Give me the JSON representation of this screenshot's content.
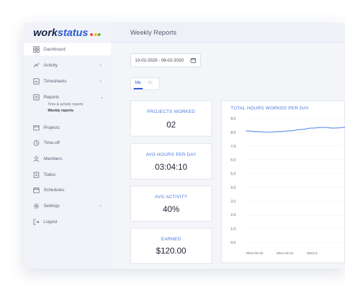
{
  "app": {
    "logo_text": "work",
    "logo_accent": "status",
    "logo_dots": [
      "#e8452c",
      "#f2b233",
      "#47b04b"
    ]
  },
  "header": {
    "title": "Weekly Reports"
  },
  "sidebar": {
    "items": [
      {
        "label": "Dashboard",
        "icon": "dashboard-icon",
        "has_chevron": false,
        "active": true
      },
      {
        "label": "Activity",
        "icon": "activity-icon",
        "has_chevron": true
      },
      {
        "label": "Timesheets",
        "icon": "timesheet-icon",
        "has_chevron": true
      },
      {
        "label": "Reports",
        "icon": "reports-icon",
        "has_chevron": true,
        "expanded": true
      },
      {
        "label": "Projects",
        "icon": "projects-icon",
        "has_chevron": false
      },
      {
        "label": "Time-off",
        "icon": "timeoff-icon",
        "has_chevron": false
      },
      {
        "label": "Members",
        "icon": "members-icon",
        "has_chevron": false
      },
      {
        "label": "Todos",
        "icon": "todos-icon",
        "has_chevron": false
      },
      {
        "label": "Schedules",
        "icon": "schedules-icon",
        "has_chevron": false
      },
      {
        "label": "Settings",
        "icon": "settings-icon",
        "has_chevron": true
      },
      {
        "label": "Logout",
        "icon": "logout-icon",
        "has_chevron": false
      }
    ],
    "reports_sub": [
      "Time & activity reports",
      "Weekly reports"
    ]
  },
  "filters": {
    "date_range": "10-02-2020 - 09-02-2020",
    "toggle_me": "Me",
    "toggle_all": "All"
  },
  "cards": [
    {
      "title": "PROJECTS WORKED",
      "value": "02"
    },
    {
      "title": "AVG HOURS PER DAY",
      "value": "03:04:10"
    },
    {
      "title": "AVG ACTIVITY",
      "value": "40%"
    },
    {
      "title": "EARNED",
      "value": "$120.00"
    }
  ],
  "colors": {
    "accent": "#4b78e2",
    "line": "#5b8be6"
  },
  "chart_data": {
    "type": "line",
    "title": "TOTAL HOURS WORKED PER DAY",
    "ylim": [
      0,
      9
    ],
    "y_ticks": [
      "9.0",
      "8.0",
      "7.0",
      "6.0",
      "5.0",
      "4.0",
      "3.0",
      "2.0",
      "1.0",
      "0.0"
    ],
    "x_tick_labels": [
      "2021-03-20",
      "2021-03-21",
      "2021-0"
    ],
    "grid": true,
    "series": [
      {
        "values": [
          8.1,
          8.05,
          8.0,
          8.05,
          8.1,
          8.2,
          8.3,
          8.35,
          8.3,
          8.35
        ]
      }
    ]
  }
}
